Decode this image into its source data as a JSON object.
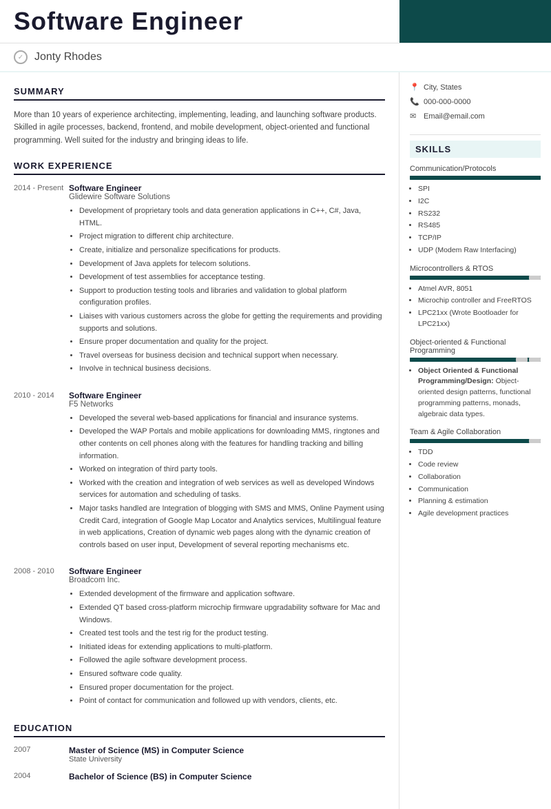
{
  "header": {
    "title": "Software Engineer",
    "accent_color": "#0d4a4a"
  },
  "name": "Jonty Rhodes",
  "contact": {
    "location": "City, States",
    "phone": "000-000-0000",
    "email": "Email@email.com"
  },
  "summary": {
    "section_title": "SUMMARY",
    "text": "More than 10 years of experience architecting, implementing, leading, and launching software products. Skilled in agile processes, backend, frontend, and mobile development, object-oriented and functional programming. Well suited for the industry and bringing ideas to life."
  },
  "work_experience": {
    "section_title": "WORK EXPERIENCE",
    "jobs": [
      {
        "dates": "2014 - Present",
        "title": "Software Engineer",
        "company": "Glidewire Software Solutions",
        "bullets": [
          "Development of proprietary tools and data generation applications in C++, C#, Java, HTML.",
          "Project migration to different chip architecture.",
          "Create, initialize and personalize specifications for products.",
          "Development of Java applets for telecom solutions.",
          "Development of test assemblies for acceptance testing.",
          "Support to production testing tools and libraries and validation to global platform configuration profiles.",
          "Liaises with various customers across the globe for getting the requirements and providing supports and solutions.",
          "Ensure proper documentation and quality for the project.",
          "Travel overseas for business decision and technical support when necessary.",
          "Involve in technical business decisions."
        ]
      },
      {
        "dates": "2010 - 2014",
        "title": "Software Engineer",
        "company": "F5 Networks",
        "bullets": [
          "Developed the several web-based applications for financial and insurance systems.",
          "Developed the WAP Portals and mobile applications for downloading MMS, ringtones and other contents on cell phones along with the features for handling tracking and billing information.",
          "Worked on integration of third party tools.",
          "Worked with the creation and integration of web services as well as developed Windows services for automation and scheduling of tasks.",
          "Major tasks handled are Integration of blogging with SMS and MMS, Online Payment using Credit Card, integration of Google Map Locator and Analytics services, Multilingual feature in web applications, Creation of dynamic web pages along with the dynamic creation of controls based on user input, Development of several reporting mechanisms etc."
        ]
      },
      {
        "dates": "2008 - 2010",
        "title": "Software Engineer",
        "company": "Broadcom Inc.",
        "bullets": [
          "Extended development of the firmware and application software.",
          "Extended QT based cross-platform microchip firmware upgradability software for Mac and Windows.",
          "Created test tools and the test rig for the product testing.",
          "Initiated ideas for extending applications to multi-platform.",
          "Followed the agile software development process.",
          "Ensured software code quality.",
          "Ensured proper documentation for the project.",
          "Point of contact for communication and followed up with vendors, clients, etc."
        ]
      }
    ]
  },
  "education": {
    "section_title": "EDUCATION",
    "entries": [
      {
        "year": "2007",
        "degree": "Master of Science (MS) in Computer Science",
        "school": "State University"
      },
      {
        "year": "2004",
        "degree": "Bachelor of Science (BS) in Computer Science",
        "school": ""
      }
    ]
  },
  "skills": {
    "section_title": "SKILLS",
    "categories": [
      {
        "title": "Communication/Protocols",
        "bar_filled": 10,
        "bar_total": 10,
        "items": [
          "SPI",
          "I2C",
          "RS232",
          "RS485",
          "TCP/IP",
          "UDP (Modem Raw Interfacing)"
        ]
      },
      {
        "title": "Microcontrollers & RTOS",
        "bar_filled": 9,
        "bar_total": 10,
        "items": [
          "Atmel AVR, 8051",
          "Microchip controller and FreeRTOS",
          "LPC21xx (Wrote Bootloader for LPC21xx)"
        ]
      },
      {
        "title": "Object-oriented & Functional Programming",
        "bar_filled": 8,
        "bar_total": 10,
        "items_bold": [
          "Object Oriented & Functional Programming/Design:"
        ],
        "items_bold_text": "Object-oriented design patterns, functional programming patterns, monads, algebraic data types.",
        "items": []
      },
      {
        "title": "Team & Agile Collaboration",
        "bar_filled": 9,
        "bar_total": 10,
        "items": [
          "TDD",
          "Code review",
          "Collaboration",
          "Communication",
          "Planning & estimation",
          "Agile development practices"
        ]
      }
    ]
  }
}
